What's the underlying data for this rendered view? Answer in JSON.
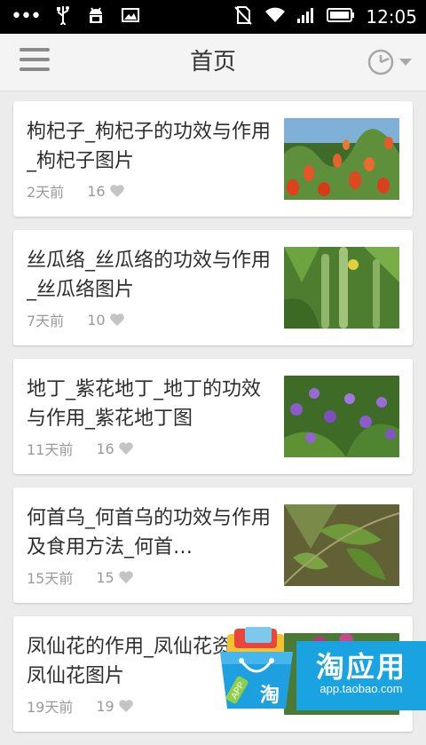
{
  "status_bar": {
    "time": "12:05",
    "icons": [
      "more-dots-icon",
      "usb-icon",
      "android-debug-icon",
      "image-icon",
      "no-sim-icon",
      "wifi-icon",
      "signal-icon",
      "battery-icon"
    ]
  },
  "header": {
    "title": "首页",
    "menu_icon": "hamburger-menu-icon",
    "history_icon": "clock-dropdown-icon"
  },
  "articles": [
    {
      "title": "枸杞子_枸杞子的功效与作用_枸杞子图片",
      "time": "2天前",
      "likes": "16"
    },
    {
      "title": "丝瓜络_丝瓜络的功效与作用_丝瓜络图片",
      "time": "7天前",
      "likes": "10"
    },
    {
      "title": "地丁_紫花地丁_地丁的功效与作用_紫花地丁图",
      "time": "11天前",
      "likes": "16"
    },
    {
      "title": "何首乌_何首乌的功效与作用及食用方法_何首…",
      "time": "15天前",
      "likes": "15"
    },
    {
      "title": "凤仙花的作用_凤仙花资料_凤仙花图片",
      "time": "19天前",
      "likes": "19"
    }
  ],
  "ad": {
    "brand": "淘应用",
    "url": "app.taobao.com",
    "badge": "APP",
    "bag_char": "淘"
  },
  "colors": {
    "background": "#ececec",
    "app_bar": "#f4f4f4",
    "meta_text": "#9a9a9a",
    "ad_blue": "#19a3e0"
  }
}
